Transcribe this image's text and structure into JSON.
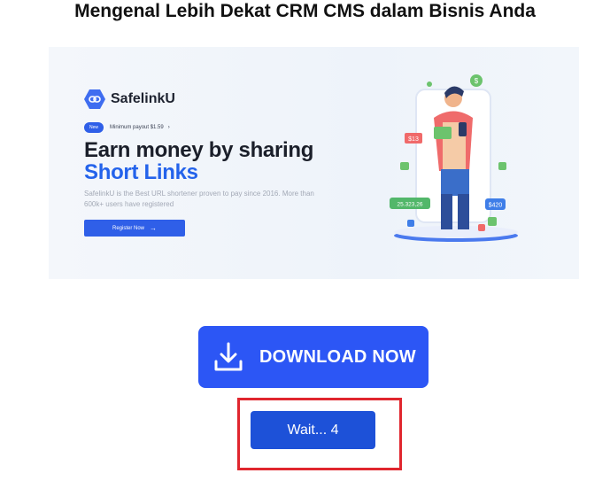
{
  "page": {
    "title": "Mengenal Lebih Dekat CRM CMS dalam Bisnis Anda"
  },
  "banner": {
    "brand": "SafelinkU",
    "badge": "New",
    "payout": "Minimum payout $1.59",
    "headline_line1": "Earn money by sharing",
    "headline_line2": "Short Links",
    "description": "SafelinkU is the Best URL shortener proven to pay since 2016. More than 600k+ users have registered",
    "cta": "Register Now",
    "illustration": {
      "tag_left_top": "$13",
      "tag_left_bottom": "25.323,26",
      "tag_right": "$420",
      "coin": "$"
    },
    "colors": {
      "primary": "#2f5fe8",
      "headline_accent": "#2463eb"
    }
  },
  "download": {
    "label": "DOWNLOAD NOW",
    "icon": "download-icon",
    "color": "#2c56f5"
  },
  "wait": {
    "label": "Wait... 4",
    "highlight_color": "#e0262e"
  }
}
